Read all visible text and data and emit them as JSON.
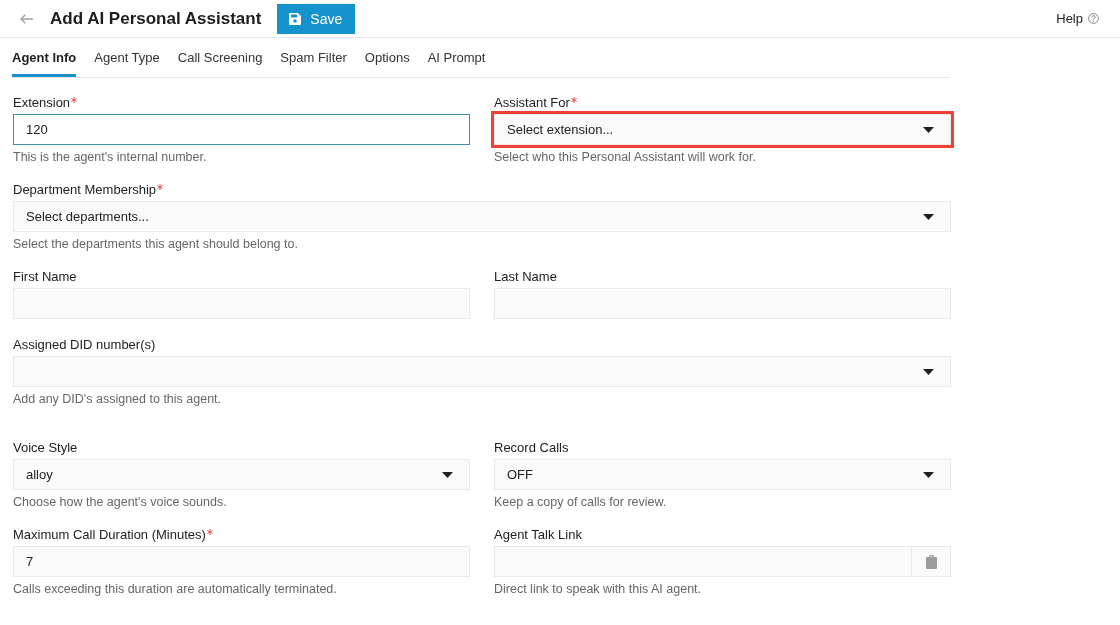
{
  "header": {
    "title": "Add AI Personal Assistant",
    "save_label": "Save",
    "help_label": "Help"
  },
  "tabs": [
    {
      "label": "Agent Info",
      "selected": true
    },
    {
      "label": "Agent Type",
      "selected": false
    },
    {
      "label": "Call Screening",
      "selected": false
    },
    {
      "label": "Spam Filter",
      "selected": false
    },
    {
      "label": "Options",
      "selected": false
    },
    {
      "label": "AI Prompt",
      "selected": false
    }
  ],
  "sections": [
    {
      "rows": [
        {
          "fields": [
            {
              "kind": "text",
              "label": "Extension",
              "required": true,
              "value": "120",
              "help": "This is the agent's internal number.",
              "focused": true,
              "highlighted": false
            },
            {
              "kind": "select",
              "label": "Assistant For",
              "required": true,
              "placeholder": "Select extension...",
              "help": "Select who this Personal Assistant will work for.",
              "focused": false,
              "highlighted": true
            }
          ]
        },
        {
          "fields": [
            {
              "kind": "select",
              "label": "Department Membership",
              "required": true,
              "placeholder": "Select departments...",
              "help": "Select the departments this agent should belong to.",
              "focused": false,
              "highlighted": false
            }
          ]
        },
        {
          "fields": [
            {
              "kind": "text",
              "label": "First Name",
              "required": false,
              "focused": false,
              "highlighted": false
            },
            {
              "kind": "text",
              "label": "Last Name",
              "required": false,
              "focused": false,
              "highlighted": false
            }
          ]
        },
        {
          "fields": [
            {
              "kind": "select",
              "label": "Assigned DID number(s)",
              "required": false,
              "help": "Add any DID's assigned to this agent.",
              "focused": false,
              "highlighted": false
            }
          ]
        }
      ]
    },
    {
      "rows": [
        {
          "fields": [
            {
              "kind": "select",
              "label": "Voice Style",
              "required": false,
              "value": "alloy",
              "help": "Choose how the agent's voice sounds.",
              "focused": false,
              "highlighted": false
            },
            {
              "kind": "select",
              "label": "Record Calls",
              "required": false,
              "value": "OFF",
              "help": "Keep a copy of calls for review.",
              "focused": false,
              "highlighted": false
            }
          ]
        },
        {
          "fields": [
            {
              "kind": "text",
              "label": "Maximum Call Duration (Minutes)",
              "required": true,
              "value": "7",
              "help": "Calls exceeding this duration are automatically terminated.",
              "focused": false,
              "highlighted": false
            },
            {
              "kind": "copy_link",
              "label": "Agent Talk Link",
              "required": false,
              "help": "Direct link to speak with this AI agent.",
              "focused": false,
              "highlighted": false
            }
          ]
        }
      ]
    }
  ]
}
